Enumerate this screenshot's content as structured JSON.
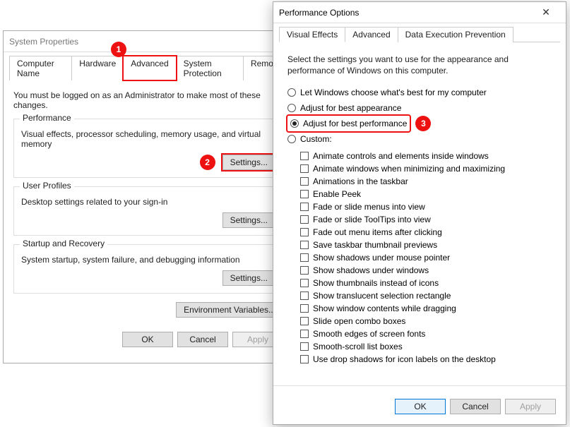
{
  "sysprops": {
    "title": "System Properties",
    "tabs": [
      "Computer Name",
      "Hardware",
      "Advanced",
      "System Protection",
      "Remote"
    ],
    "instruction": "You must be logged on as an Administrator to make most of these changes.",
    "performance": {
      "label": "Performance",
      "desc": "Visual effects, processor scheduling, memory usage, and virtual memory",
      "button": "Settings..."
    },
    "userprofiles": {
      "label": "User Profiles",
      "desc": "Desktop settings related to your sign-in",
      "button": "Settings..."
    },
    "startup": {
      "label": "Startup and Recovery",
      "desc": "System startup, system failure, and debugging information",
      "button": "Settings..."
    },
    "envvars": "Environment Variables...",
    "buttons": {
      "ok": "OK",
      "cancel": "Cancel",
      "apply": "Apply"
    }
  },
  "perfopts": {
    "title": "Performance Options",
    "close": "✕",
    "tabs": [
      "Visual Effects",
      "Advanced",
      "Data Execution Prevention"
    ],
    "instruction": "Select the settings you want to use for the appearance and performance of Windows on this computer.",
    "radios": [
      "Let Windows choose what's best for my computer",
      "Adjust for best appearance",
      "Adjust for best performance",
      "Custom:"
    ],
    "checks": [
      "Animate controls and elements inside windows",
      "Animate windows when minimizing and maximizing",
      "Animations in the taskbar",
      "Enable Peek",
      "Fade or slide menus into view",
      "Fade or slide ToolTips into view",
      "Fade out menu items after clicking",
      "Save taskbar thumbnail previews",
      "Show shadows under mouse pointer",
      "Show shadows under windows",
      "Show thumbnails instead of icons",
      "Show translucent selection rectangle",
      "Show window contents while dragging",
      "Slide open combo boxes",
      "Smooth edges of screen fonts",
      "Smooth-scroll list boxes",
      "Use drop shadows for icon labels on the desktop"
    ],
    "buttons": {
      "ok": "OK",
      "cancel": "Cancel",
      "apply": "Apply"
    }
  },
  "markers": {
    "m1": "1",
    "m2": "2",
    "m3": "3"
  }
}
